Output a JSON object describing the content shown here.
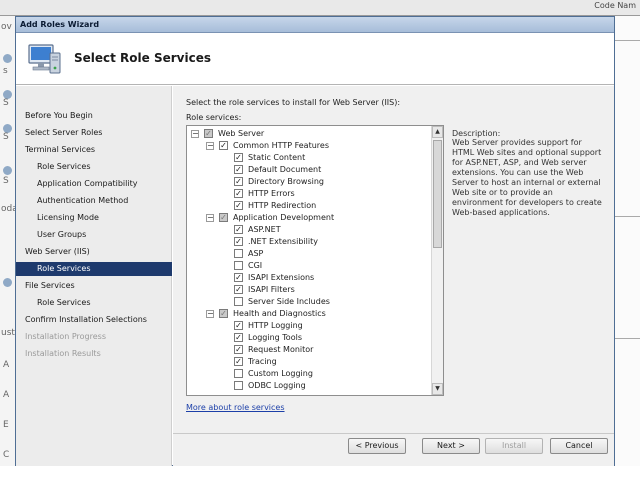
{
  "background": {
    "top_right_text": "Code Nam",
    "left_fragments": [
      "ov",
      "s",
      "S",
      "S",
      "S",
      "oda",
      "ust",
      "A",
      "A",
      "E",
      "C"
    ]
  },
  "window": {
    "title": "Add Roles Wizard"
  },
  "header": {
    "title": "Select Role Services"
  },
  "nav": {
    "items": [
      {
        "label": "Before You Begin"
      },
      {
        "label": "Select Server Roles"
      },
      {
        "label": "Terminal Services"
      },
      {
        "label": "Role Services"
      },
      {
        "label": "Application Compatibility"
      },
      {
        "label": "Authentication Method"
      },
      {
        "label": "Licensing Mode"
      },
      {
        "label": "User Groups"
      },
      {
        "label": "Web Server (IIS)"
      },
      {
        "label": "Role Services"
      },
      {
        "label": "File Services"
      },
      {
        "label": "Role Services"
      },
      {
        "label": "Confirm Installation Selections"
      },
      {
        "label": "Installation Progress"
      },
      {
        "label": "Installation Results"
      }
    ]
  },
  "content": {
    "instruction": "Select the role services to install for Web Server (IIS):",
    "role_services_label": "Role services:",
    "tree": [
      {
        "label": "Web Server"
      },
      {
        "label": "Common HTTP Features"
      },
      {
        "label": "Static Content"
      },
      {
        "label": "Default Document"
      },
      {
        "label": "Directory Browsing"
      },
      {
        "label": "HTTP Errors"
      },
      {
        "label": "HTTP Redirection"
      },
      {
        "label": "Application Development"
      },
      {
        "label": "ASP.NET"
      },
      {
        "label": ".NET Extensibility"
      },
      {
        "label": "ASP"
      },
      {
        "label": "CGI"
      },
      {
        "label": "ISAPI Extensions"
      },
      {
        "label": "ISAPI Filters"
      },
      {
        "label": "Server Side Includes"
      },
      {
        "label": "Health and Diagnostics"
      },
      {
        "label": "HTTP Logging"
      },
      {
        "label": "Logging Tools"
      },
      {
        "label": "Request Monitor"
      },
      {
        "label": "Tracing"
      },
      {
        "label": "Custom Logging"
      },
      {
        "label": "ODBC Logging"
      }
    ],
    "description_label": "Description:",
    "description_text": "Web Server provides support for HTML Web sites and optional support for ASP.NET, ASP, and Web server extensions. You can use the Web Server to host an internal or external Web site or to provide an environment for developers to create Web-based applications.",
    "more_link": "More about role services"
  },
  "buttons": {
    "previous": "< Previous",
    "next": "Next >",
    "install": "Install",
    "cancel": "Cancel"
  }
}
